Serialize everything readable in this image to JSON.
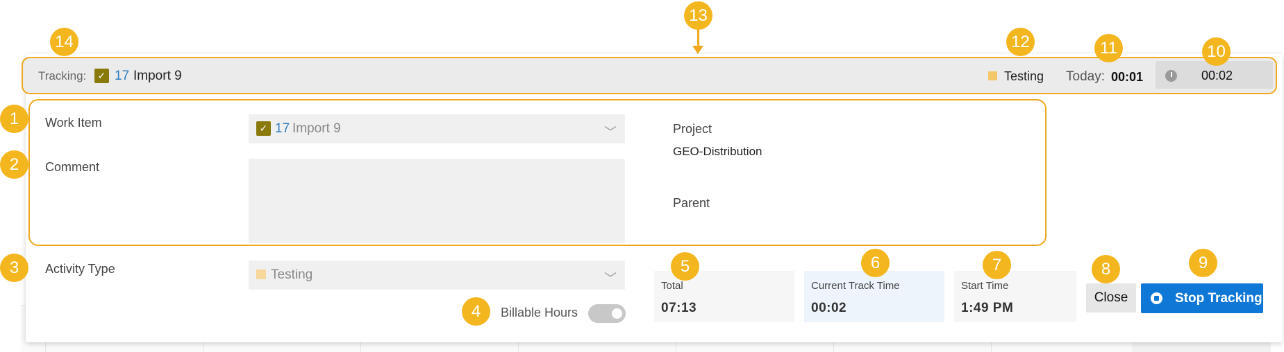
{
  "tracking_bar": {
    "label": "Tracking:",
    "work_item_id": "17",
    "work_item_name": "Import 9",
    "activity": "Testing",
    "today_label": "Today:",
    "today_value": "00:01",
    "timer_value": "00:02"
  },
  "form": {
    "work_item_label": "Work Item",
    "work_item_id": "17",
    "work_item_name": "Import 9",
    "comment_label": "Comment",
    "comment_value": "",
    "project_label": "Project",
    "project_value": "GEO-Distribution",
    "parent_label": "Parent",
    "activity_type_label": "Activity Type",
    "activity_type_value": "Testing",
    "billable_label": "Billable Hours"
  },
  "stats": {
    "total_label": "Total",
    "total_value": "07:13",
    "current_label": "Current Track Time",
    "current_value": "00:02",
    "start_label": "Start Time",
    "start_value": "1:49 PM"
  },
  "buttons": {
    "close": "Close",
    "stop": "Stop Tracking"
  },
  "callouts": [
    "1",
    "2",
    "3",
    "4",
    "5",
    "6",
    "7",
    "8",
    "9",
    "10",
    "11",
    "12",
    "13",
    "14"
  ],
  "colors": {
    "highlight": "#f0a81e",
    "badge": "#f4b61e",
    "primary": "#0f78d7",
    "checkbox": "#8a7a0c",
    "activity_swatch": "#f5c76b"
  }
}
